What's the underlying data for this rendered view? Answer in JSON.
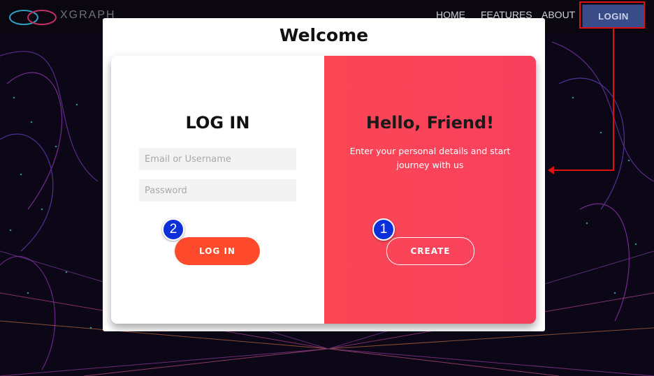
{
  "app": {
    "logo_text": "XGRAPH"
  },
  "nav": {
    "home": "HOME",
    "features": "FEATURES",
    "about": "ABOUT",
    "login_button": "LOGIN"
  },
  "modal": {
    "title": "Welcome",
    "login_panel": {
      "heading": "LOG IN",
      "email_placeholder": "Email or Username",
      "password_placeholder": "Password",
      "submit_label": "LOG IN"
    },
    "signup_panel": {
      "heading": "Hello, Friend!",
      "description": "Enter your personal details and start journey with us",
      "create_label": "CREATE"
    }
  },
  "annotations": {
    "badge_1": "1",
    "badge_2": "2"
  },
  "colors": {
    "accent_red": "#ff4b2b",
    "panel_pink": "#fb4654",
    "nav_login_bg": "#3a4b8a",
    "annotation_red": "#e01010",
    "badge_blue": "#0b2fd8"
  }
}
